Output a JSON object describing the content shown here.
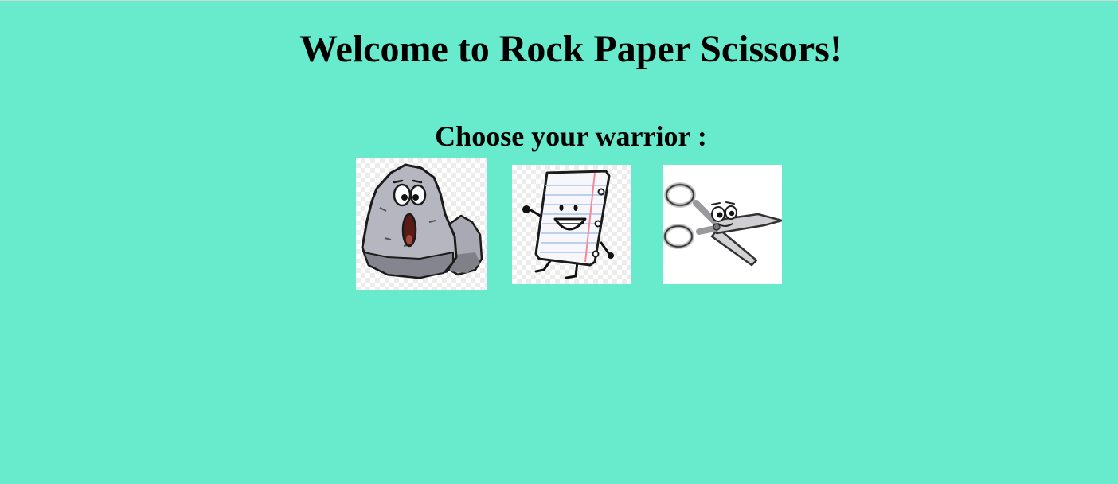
{
  "page": {
    "title": "Welcome to Rock Paper Scissors!",
    "subtitle": "Choose your warrior :",
    "background_color": "#67ebcc"
  },
  "warriors": [
    {
      "id": "rock",
      "image": "cartoon-rock-icon"
    },
    {
      "id": "paper",
      "image": "cartoon-notebook-paper-icon"
    },
    {
      "id": "scissors",
      "image": "cartoon-scissors-icon"
    }
  ]
}
